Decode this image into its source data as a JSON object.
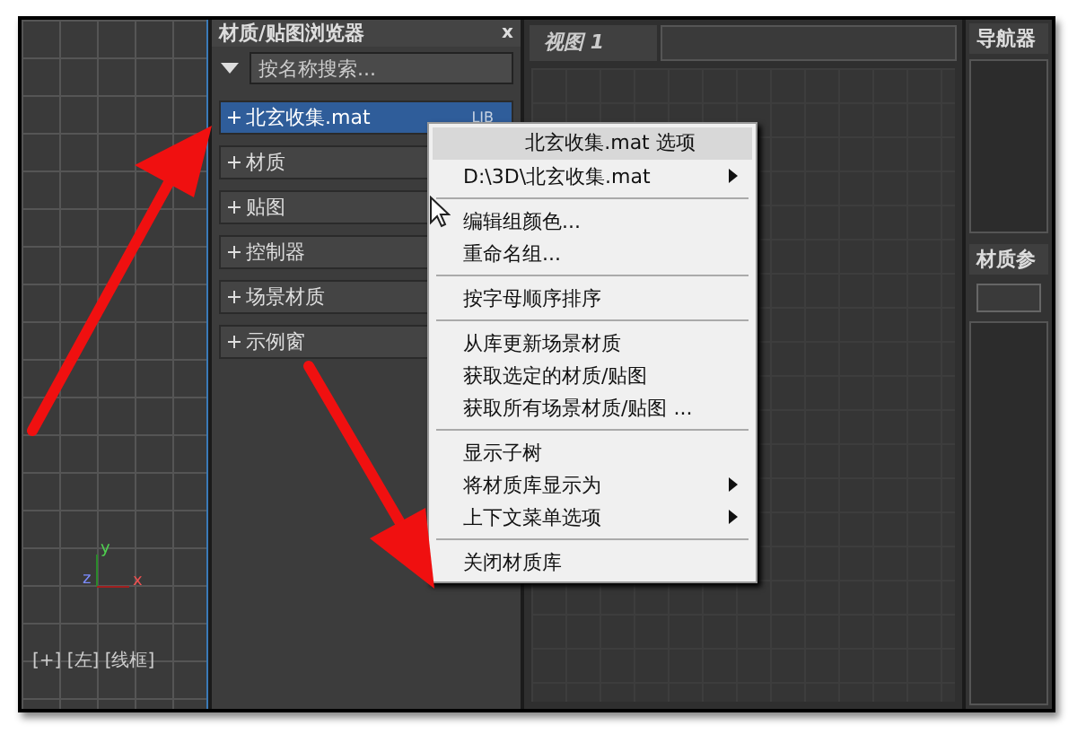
{
  "viewport_left": {
    "axis_labels": [
      "y",
      "z",
      "x"
    ],
    "label": "[+] [左] [线框]"
  },
  "browser": {
    "title": "材质/贴图浏览器",
    "close": "x",
    "search": {
      "placeholder": "按名称搜索..."
    },
    "groups": [
      {
        "label": "北玄收集.mat",
        "tag": "LIB",
        "selected": true,
        "expanded": false
      },
      {
        "label": "材质",
        "selected": false,
        "expanded": false
      },
      {
        "label": "贴图",
        "selected": false,
        "expanded": false
      },
      {
        "label": "控制器",
        "selected": false,
        "expanded": false
      },
      {
        "label": "场景材质",
        "selected": false,
        "expanded": false
      },
      {
        "label": "示例窗",
        "selected": false,
        "expanded": false
      }
    ]
  },
  "view": {
    "tab": "视图 1"
  },
  "navigator": {
    "title": "导航器"
  },
  "material_params": {
    "title": "材质参"
  },
  "context_menu": {
    "items": [
      {
        "kind": "header",
        "label": "北玄收集.mat 选项",
        "selected": true
      },
      {
        "kind": "item",
        "label": "D:\\3D\\北玄收集.mat",
        "submenu": true,
        "selected": false
      },
      {
        "kind": "separator"
      },
      {
        "kind": "item",
        "label": "编辑组颜色...",
        "submenu": false,
        "selected": false
      },
      {
        "kind": "item",
        "label": "重命名组...",
        "submenu": false,
        "selected": false
      },
      {
        "kind": "separator"
      },
      {
        "kind": "item",
        "label": "按字母顺序排序",
        "submenu": false,
        "selected": false
      },
      {
        "kind": "separator"
      },
      {
        "kind": "item",
        "label": "从库更新场景材质",
        "submenu": false,
        "selected": false
      },
      {
        "kind": "item",
        "label": "获取选定的材质/贴图",
        "submenu": false,
        "selected": false
      },
      {
        "kind": "item",
        "label": "获取所有场景材质/贴图 ...",
        "submenu": false,
        "selected": false
      },
      {
        "kind": "separator"
      },
      {
        "kind": "item",
        "label": "显示子树",
        "submenu": false,
        "selected": false
      },
      {
        "kind": "item",
        "label": "将材质库显示为",
        "submenu": true,
        "selected": false
      },
      {
        "kind": "item",
        "label": "上下文菜单选项",
        "submenu": true,
        "selected": false
      },
      {
        "kind": "separator"
      },
      {
        "kind": "item",
        "label": "关闭材质库",
        "submenu": false,
        "selected": false
      }
    ]
  }
}
